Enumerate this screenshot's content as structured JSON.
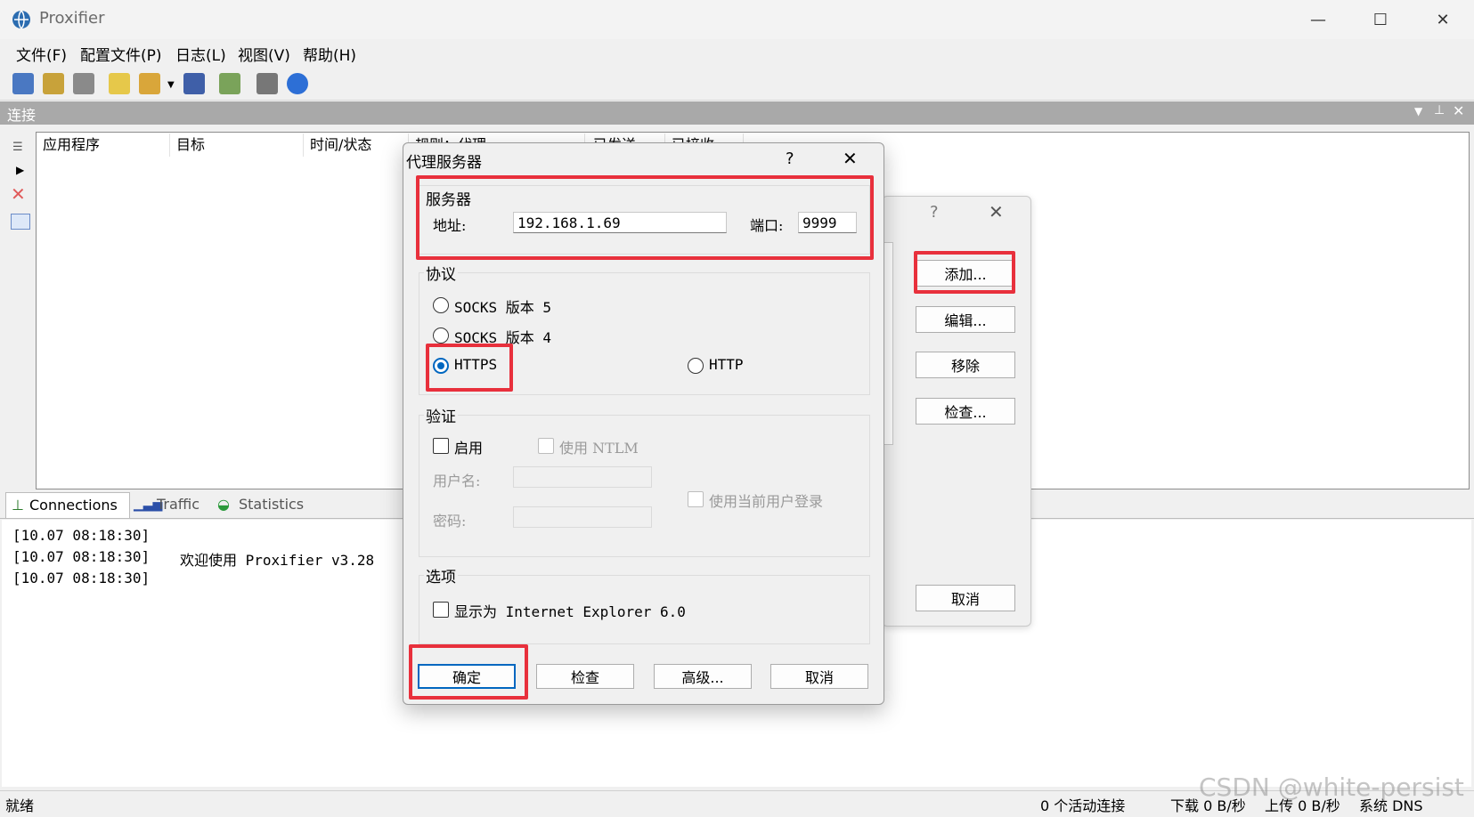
{
  "window": {
    "title": "Proxifier",
    "controls": [
      "—",
      "☐",
      "✕"
    ]
  },
  "menu": [
    "文件(F)",
    "配置文件(P)",
    "日志(L)",
    "视图(V)",
    "帮助(H)"
  ],
  "panel": {
    "label": "连接"
  },
  "columns": [
    "应用程序",
    "目标",
    "时间/状态",
    "规则：代理",
    "已发送",
    "已接收"
  ],
  "tabs": {
    "connections": "Connections",
    "traffic": "Traffic",
    "statistics": "Statistics"
  },
  "log": [
    {
      "time": "[10.07 08:18:30]",
      "msg": ""
    },
    {
      "time": "[10.07 08:18:30]",
      "msg": "欢迎使用 Proxifier v3.28"
    },
    {
      "time": "[10.07 08:18:30]",
      "msg": ""
    }
  ],
  "status": {
    "ready": "就绪",
    "active": "0 个活动连接",
    "down": "下载 0 B/秒",
    "up": "上传 0 B/秒",
    "dns": "系统 DNS"
  },
  "watermark": "CSDN @white-persist",
  "bg_dialog": {
    "help": "?",
    "close": "✕",
    "buttons": {
      "add": "添加...",
      "edit": "编辑...",
      "remove": "移除",
      "check": "检查...",
      "cancel": "取消"
    }
  },
  "proxy_dialog": {
    "title": "代理服务器",
    "help": "?",
    "close": "✕",
    "server": {
      "group": "服务器",
      "address_label": "地址:",
      "address_value": "192.168.1.69",
      "port_label": "端口:",
      "port_value": "9999"
    },
    "protocol": {
      "group": "协议",
      "socks5": "SOCKS 版本 5",
      "socks4": "SOCKS 版本 4",
      "https": "HTTPS",
      "http": "HTTP",
      "selected": "HTTPS"
    },
    "auth": {
      "group": "验证",
      "enable": "启用",
      "ntlm": "使用 NTLM",
      "user_label": "用户名:",
      "pass_label": "密码:",
      "current_user": "使用当前用户登录"
    },
    "options": {
      "group": "选项",
      "ie": "显示为 Internet Explorer 6.0"
    },
    "buttons": {
      "ok": "确定",
      "check": "检查",
      "advanced": "高级...",
      "cancel": "取消"
    }
  },
  "colors": {
    "highlight": "#e8303c",
    "accent": "#0067c0",
    "panel_header": "#a9a9a9"
  }
}
